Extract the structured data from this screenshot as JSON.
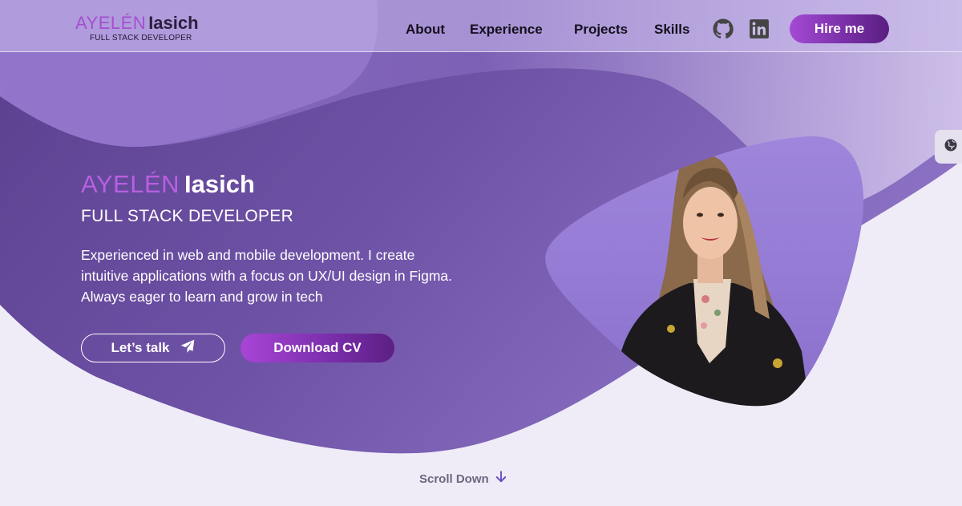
{
  "brand": {
    "first_name": "AYELÉN",
    "last_name": "Iasich",
    "role": "FULL STACK DEVELOPER"
  },
  "nav": {
    "links": [
      "About",
      "Experience",
      "Projects",
      "Skills"
    ],
    "icons": [
      "github-icon",
      "linkedin-icon"
    ],
    "hire_label": "Hire me"
  },
  "hero": {
    "first_name": "AYELÉN",
    "last_name": "Iasich",
    "role": "FULL STACK DEVELOPER",
    "description": "Experienced in web and mobile development. I create intuitive applications with a focus on UX/UI design in Figma. Always eager to learn and grow in tech",
    "talk_label": "Let’s talk",
    "cv_label": "Download CV"
  },
  "side_tab": {
    "icon": "globe-icon"
  },
  "scroll": {
    "label": "Scroll Down"
  },
  "colors": {
    "accent_purple": "#a54fcf",
    "hero_purple": "#6e4fa3",
    "page_bg": "#efecf8"
  }
}
